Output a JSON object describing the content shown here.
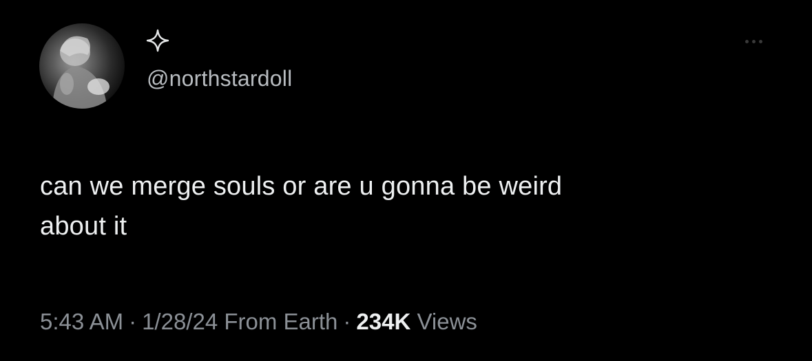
{
  "tweet": {
    "handle": "@northstardoll",
    "display_name_icon": "four-point-star-icon",
    "text_line1": "can we merge souls or are u gonna be weird",
    "text_line2": "about it",
    "time": "5:43 AM",
    "separator": "·",
    "date": "1/28/24",
    "source": "From Earth",
    "views_count": "234K",
    "views_label": "Views"
  },
  "menu": {
    "icon": "more-horizontal-icon"
  },
  "colors": {
    "background": "#000000",
    "primary_text": "#eef0f1",
    "secondary_text": "#8b9096"
  }
}
